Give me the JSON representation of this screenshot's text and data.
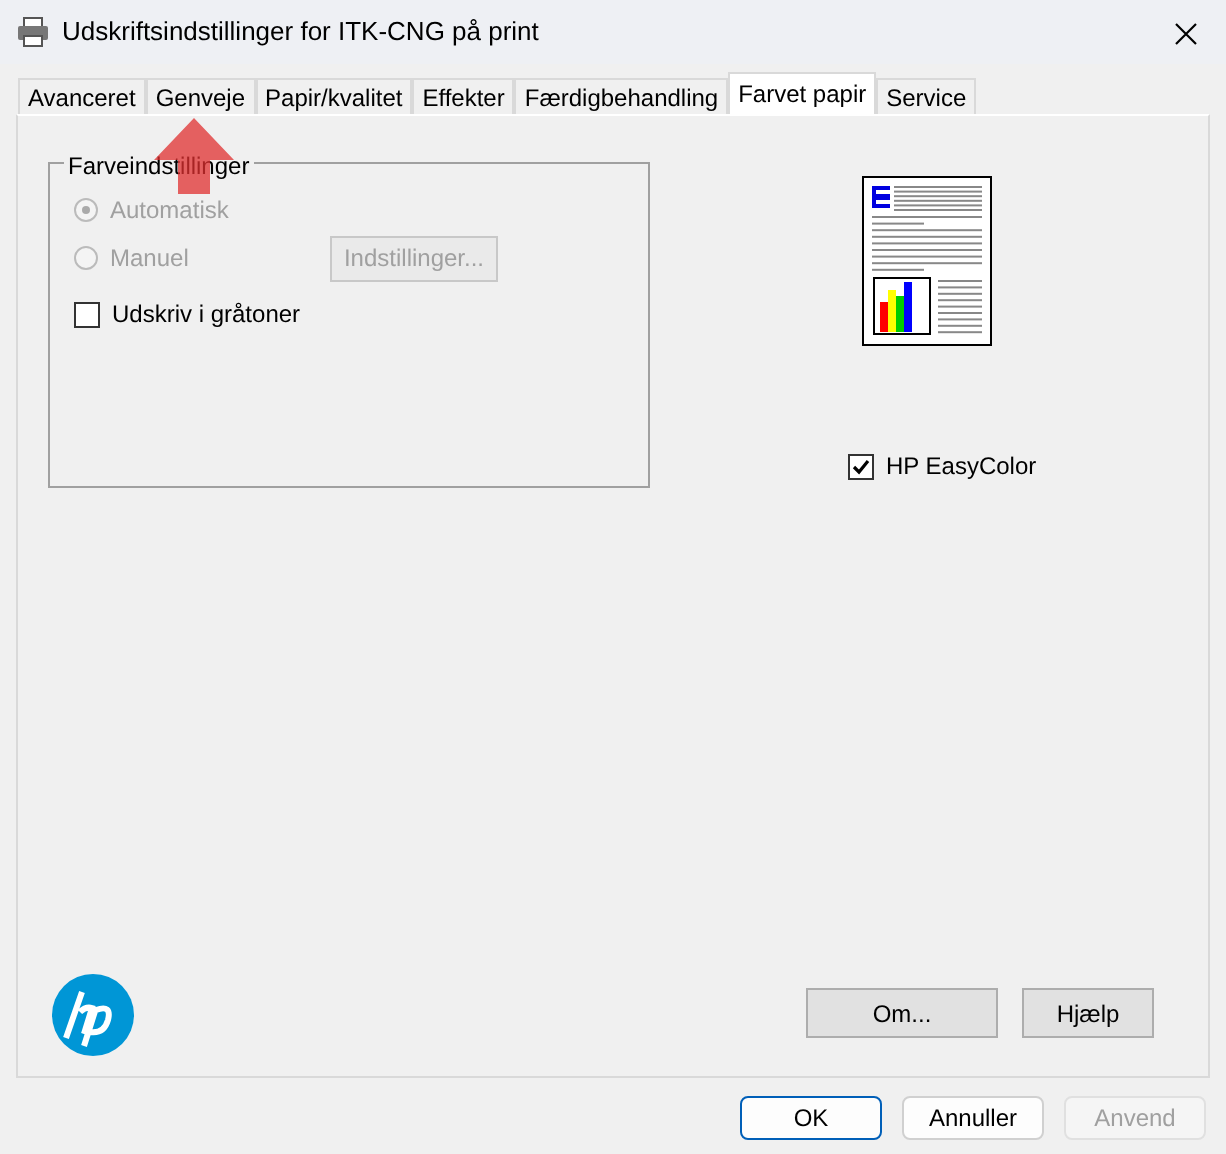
{
  "window": {
    "title": "Udskriftsindstillinger for ITK-CNG på print"
  },
  "tabs": [
    {
      "label": "Avanceret",
      "selected": false
    },
    {
      "label": "Genveje",
      "selected": false
    },
    {
      "label": "Papir/kvalitet",
      "selected": false
    },
    {
      "label": "Effekter",
      "selected": false
    },
    {
      "label": "Færdigbehandling",
      "selected": false
    },
    {
      "label": "Farvet papir",
      "selected": true
    },
    {
      "label": "Service",
      "selected": false
    }
  ],
  "color_settings": {
    "legend": "Farveindstillinger",
    "options": [
      {
        "label": "Automatisk",
        "selected": true,
        "disabled": true
      },
      {
        "label": "Manuel",
        "selected": false,
        "disabled": true
      }
    ],
    "settings_button": {
      "label": "Indstillinger...",
      "disabled": true
    },
    "grayscale": {
      "label": "Udskriv i gråtoner",
      "checked": false
    }
  },
  "easycolor": {
    "label": "HP EasyColor",
    "checked": true
  },
  "panel_buttons": [
    "Om...",
    "Hjælp"
  ],
  "dialog_buttons": [
    {
      "label": "OK",
      "kind": "default",
      "disabled": false
    },
    {
      "label": "Annuller",
      "kind": "normal",
      "disabled": false
    },
    {
      "label": "Anvend",
      "kind": "normal",
      "disabled": true
    }
  ]
}
